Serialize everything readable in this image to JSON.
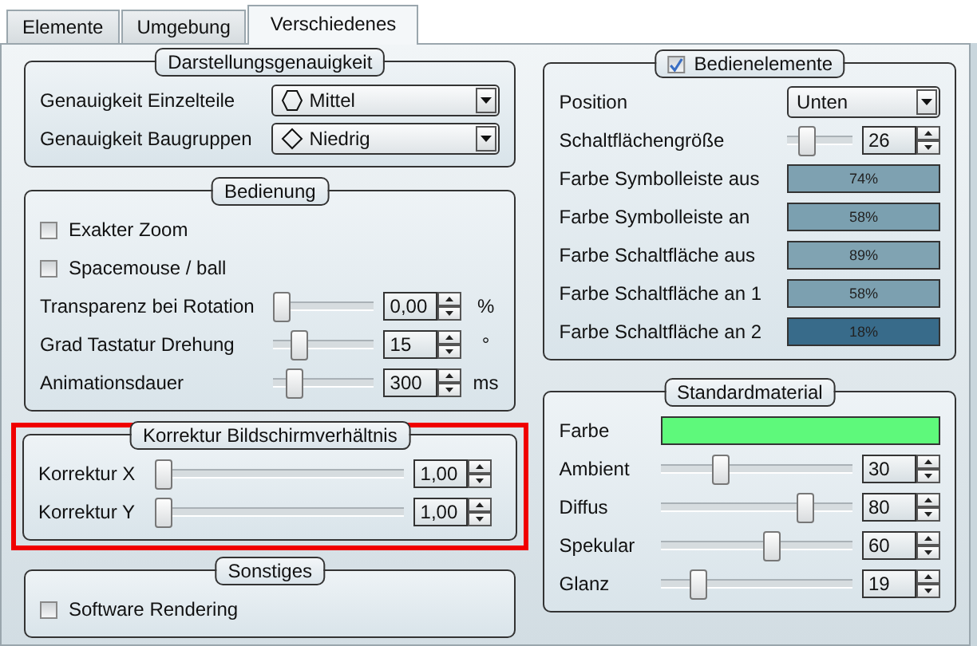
{
  "tabs": [
    {
      "label": "Elemente",
      "selected": false
    },
    {
      "label": "Umgebung",
      "selected": false
    },
    {
      "label": "Verschiedenes",
      "selected": true
    }
  ],
  "left_groups": [
    {
      "title": "Darstellungsgenauigkeit",
      "highlighted": false,
      "rows": [
        {
          "kind": "dropdown",
          "label": "Genauigkeit Einzelteile",
          "option": {
            "kind": "hexagon",
            "text": "Mittel"
          }
        },
        {
          "kind": "dropdown",
          "label": "Genauigkeit Baugruppen",
          "option": {
            "kind": "diamond",
            "text": "Niedrig"
          }
        }
      ]
    },
    {
      "title": "Bedienung",
      "highlighted": false,
      "rows": [
        {
          "kind": "checkbox",
          "label": "Exakter Zoom",
          "checked": false
        },
        {
          "kind": "checkbox",
          "label": "Spacemouse / ball",
          "checked": false
        },
        {
          "kind": "slider",
          "label": "Transparenz bei Rotation",
          "level": 0,
          "value": "0,00",
          "unit": "%"
        },
        {
          "kind": "slider",
          "label": "Grad Tastatur Drehung",
          "level": 0.2,
          "value": "15",
          "unit": "°"
        },
        {
          "kind": "slider",
          "label": "Animationsdauer",
          "level": 0.15,
          "value": "300",
          "unit": "ms"
        }
      ]
    },
    {
      "title": "Korrektur Bildschirmverhältnis",
      "highlighted": true,
      "rows": [
        {
          "kind": "slider",
          "label": "Korrektur X",
          "level": 0,
          "value": "1,00"
        },
        {
          "kind": "slider",
          "label": "Korrektur Y",
          "level": 0,
          "value": "1,00"
        }
      ]
    },
    {
      "title": "Sonstiges",
      "highlighted": false,
      "rows": [
        {
          "kind": "checkbox",
          "label": "Software Rendering",
          "checked": false
        }
      ]
    }
  ],
  "right_groups": [
    {
      "title": "Bedienelemente",
      "checked": true,
      "highlighted": false,
      "rows": [
        {
          "kind": "dropdown",
          "label": "Position",
          "option": {
            "text": "Unten"
          }
        },
        {
          "kind": "slider",
          "label": "Schaltflächengröße",
          "level": 0.22,
          "value": "26"
        },
        {
          "kind": "swatch",
          "label": "Farbe Symbolleiste aus",
          "value": "74%",
          "color": "#7ea1b1"
        },
        {
          "kind": "swatch",
          "label": "Farbe Symbolleiste an",
          "value": "58%",
          "color": "#7ba0b0"
        },
        {
          "kind": "swatch",
          "label": "Farbe Schaltfläche aus",
          "value": "89%",
          "color": "#80a3b2"
        },
        {
          "kind": "swatch",
          "label": "Farbe Schaltfläche an 1",
          "value": "58%",
          "color": "#7ca0b0"
        },
        {
          "kind": "swatch",
          "label": "Farbe Schaltfläche an 2",
          "value": "18%",
          "color": "#386b8a"
        }
      ]
    },
    {
      "title": "Standardmaterial",
      "highlighted": false,
      "rows": [
        {
          "kind": "swatch",
          "label": "Farbe",
          "color": "#5ef97b"
        },
        {
          "kind": "slider",
          "label": "Ambient",
          "level": 0.3,
          "value": "30"
        },
        {
          "kind": "slider",
          "label": "Diffus",
          "level": 0.78,
          "value": "80"
        },
        {
          "kind": "slider",
          "label": "Spekular",
          "level": 0.59,
          "value": "60"
        },
        {
          "kind": "slider",
          "label": "Glanz",
          "level": 0.17,
          "value": "19"
        }
      ]
    }
  ]
}
